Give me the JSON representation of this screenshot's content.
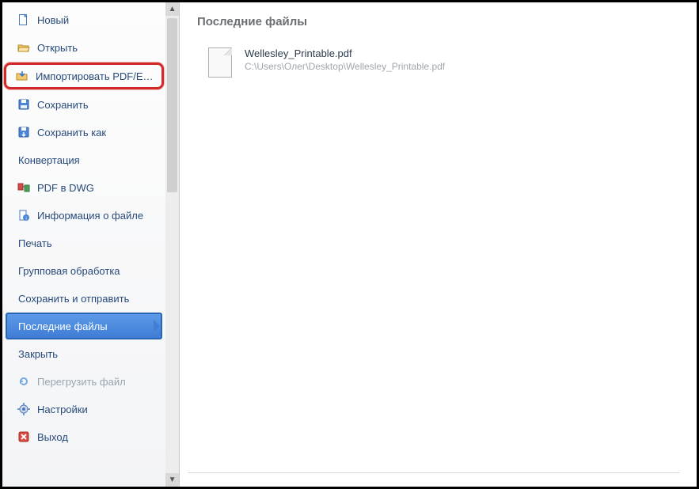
{
  "content": {
    "heading": "Последние файлы",
    "recent": [
      {
        "name": "Wellesley_Printable.pdf",
        "path": "C:\\Users\\Олег\\Desktop\\Wellesley_Printable.pdf"
      }
    ]
  },
  "sidebar": {
    "items": [
      {
        "label": "Новый",
        "icon": "new-file-icon",
        "interactable": true
      },
      {
        "label": "Открыть",
        "icon": "open-icon",
        "interactable": true
      },
      {
        "label": "Импортировать PDF/EMF",
        "icon": "import-icon",
        "interactable": true,
        "highlight": true
      },
      {
        "label": "Сохранить",
        "icon": "save-icon",
        "interactable": true
      },
      {
        "label": "Сохранить как",
        "icon": "save-as-icon",
        "interactable": true
      },
      {
        "label": "Конвертация",
        "icon": null,
        "interactable": true
      },
      {
        "label": "PDF в DWG",
        "icon": "pdf-dwg-icon",
        "interactable": true
      },
      {
        "label": "Информация о файле",
        "icon": "info-icon",
        "interactable": true
      },
      {
        "label": "Печать",
        "icon": null,
        "interactable": true
      },
      {
        "label": "Групповая обработка",
        "icon": null,
        "interactable": true
      },
      {
        "label": "Сохранить и отправить",
        "icon": null,
        "interactable": true
      },
      {
        "label": "Последние файлы",
        "icon": null,
        "interactable": true,
        "selected": true
      },
      {
        "label": "Закрыть",
        "icon": null,
        "interactable": true
      },
      {
        "label": "Перегрузить файл",
        "icon": "reload-icon",
        "interactable": false,
        "disabled": true
      },
      {
        "label": "Настройки",
        "icon": "settings-icon",
        "interactable": true
      },
      {
        "label": "Выход",
        "icon": "exit-icon",
        "interactable": true
      }
    ]
  }
}
